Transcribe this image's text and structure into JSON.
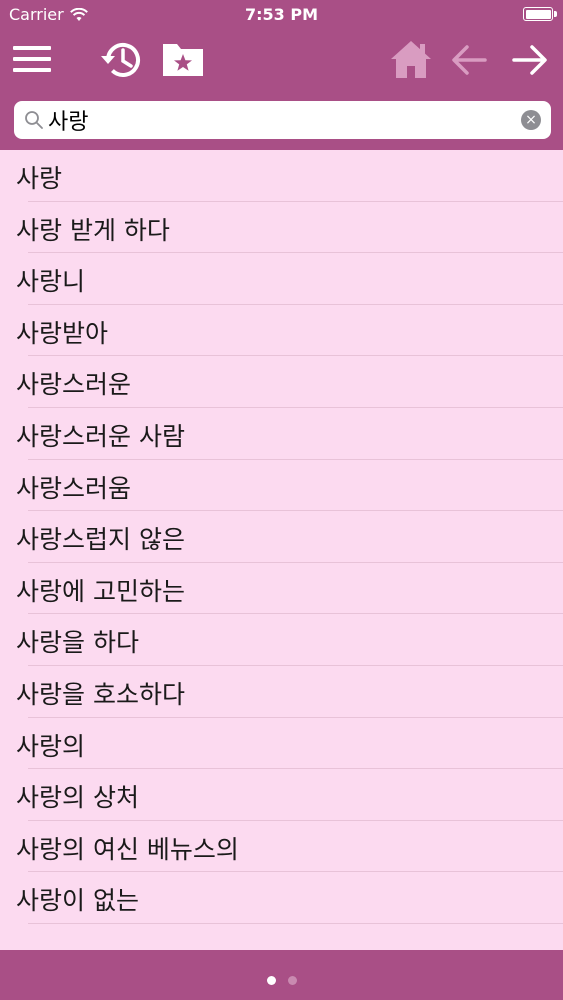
{
  "status_bar": {
    "carrier": "Carrier",
    "time": "7:53 PM"
  },
  "toolbar": {
    "menu_icon": "hamburger-menu-icon",
    "history_icon": "history-icon",
    "favorites_icon": "favorites-folder-icon",
    "home_icon": "home-icon",
    "back_icon": "arrow-left-icon",
    "forward_icon": "arrow-right-icon"
  },
  "search": {
    "value": "사랑",
    "placeholder": ""
  },
  "results": [
    "사랑",
    "사랑 받게 하다",
    "사랑니",
    "사랑받아",
    "사랑스러운",
    "사랑스러운 사람",
    "사랑스러움",
    "사랑스럽지 않은",
    "사랑에 고민하는",
    "사랑을 하다",
    "사랑을 호소하다",
    "사랑의",
    "사랑의 상처",
    "사랑의 여신 베뉴스의",
    "사랑이 없는"
  ],
  "colors": {
    "bar": "#a94f86",
    "list_background": "#fcdaf0",
    "separator": "#e8c2d8",
    "disabled_icon": "#d99cc1"
  },
  "pager": {
    "count": 2,
    "active": 0
  }
}
